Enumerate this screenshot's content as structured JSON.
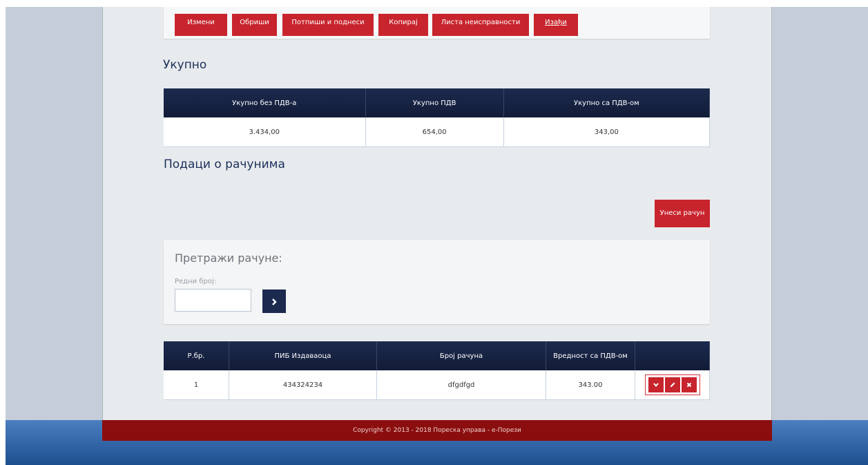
{
  "actions": {
    "edit": "Измени",
    "delete": "Обриши",
    "sign": "Потпиши и поднеси",
    "copy": "Копирај",
    "faults": "Листа неисправности",
    "exit": "Изађи"
  },
  "totals": {
    "heading": "Укупно",
    "headers": [
      "Укупно без ПДВ-а",
      "Укупно ПДВ",
      "Укупно са ПДВ-ом"
    ],
    "values": [
      "3.434,00",
      "654,00",
      "343,00"
    ]
  },
  "bills": {
    "heading": "Подаци о рачунима",
    "enter_button": "Унеси рачун",
    "search": {
      "title": "Претражи рачуне:",
      "field_label": "Редни број:",
      "input_value": "",
      "go_icon": "chevron-right-icon"
    },
    "headers": [
      "Р.бр.",
      "ПИБ Издаваоца",
      "Број рачуна",
      "Вредност са ПДВ-ом",
      ""
    ],
    "rows": [
      {
        "no": "1",
        "pib": "434324234",
        "number": "dfgdfgd",
        "value": "343.00"
      }
    ],
    "row_icons": [
      "chevron-down-icon",
      "pencil-icon",
      "close-icon"
    ]
  },
  "footer": "Copyright © 2013 - 2018 Пореска управа - е-Порези",
  "colors": {
    "accent": "#c8242d",
    "navy": "#1b2a4e",
    "footer": "#8b0e0e"
  }
}
